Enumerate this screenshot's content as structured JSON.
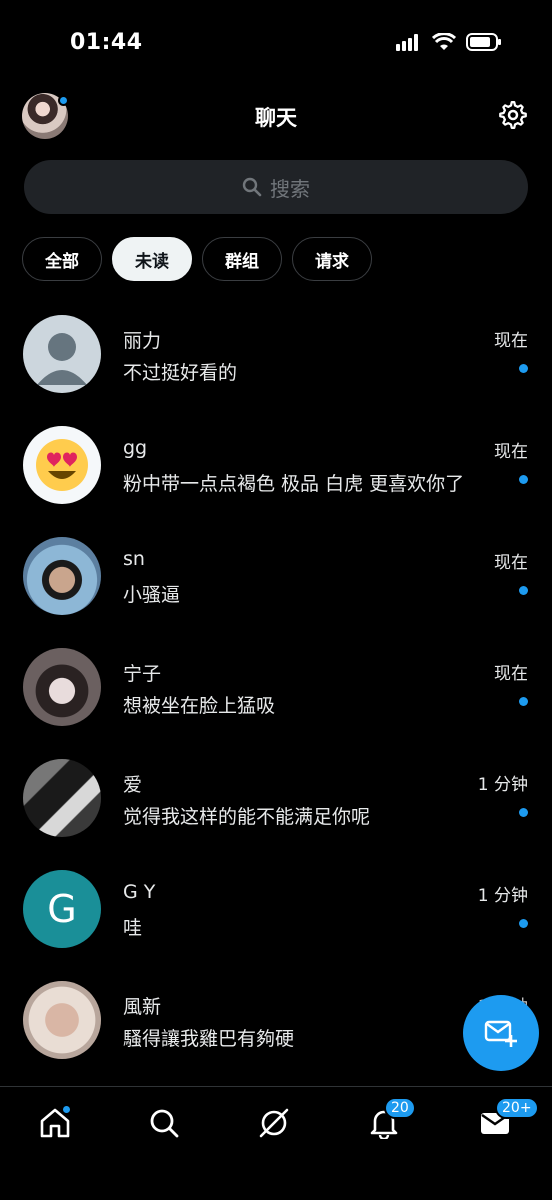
{
  "status": {
    "time": "01:44"
  },
  "header": {
    "title": "聊天"
  },
  "search": {
    "placeholder": "搜索"
  },
  "filters": [
    "全部",
    "未读",
    "群组",
    "请求"
  ],
  "active_filter": "未读",
  "conversations": [
    {
      "name": "丽力",
      "message": "不过挺好看的",
      "time": "现在",
      "unread": true
    },
    {
      "name": "gg",
      "message": "粉中带一点点褐色 极品 白虎 更喜欢你了",
      "time": "现在",
      "unread": true
    },
    {
      "name": "sn",
      "message": "小骚逼",
      "time": "现在",
      "unread": true
    },
    {
      "name": "宁子",
      "message": "想被坐在脸上猛吸",
      "time": "现在",
      "unread": true
    },
    {
      "name": "爱",
      "message": "觉得我这样的能不能满足你呢",
      "time": "1 分钟",
      "unread": true
    },
    {
      "name": "G Y",
      "message": "哇",
      "time": "1 分钟",
      "unread": true,
      "avatar_letter": "G"
    },
    {
      "name": "風新",
      "message": "騷得讓我雞巴有夠硬",
      "time": "1 分钟",
      "unread": false
    }
  ],
  "nav": {
    "notifications_badge": "20",
    "messages_badge": "20+"
  },
  "colors": {
    "accent": "#1d9bf0",
    "background": "#000000",
    "search_bg": "#202327"
  },
  "icons": [
    "home-icon",
    "search-icon",
    "grok-icon",
    "bell-icon",
    "mail-icon",
    "settings-icon",
    "new-message-icon"
  ]
}
